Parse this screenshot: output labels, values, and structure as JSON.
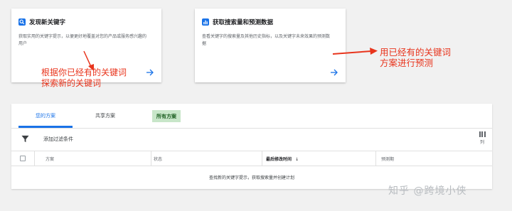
{
  "cards": [
    {
      "title": "发现新关键字",
      "description": "获取实用的关键字提示，以便更好地覆盖对您的产品或服务感兴趣的用户",
      "icon": "search-icon"
    },
    {
      "title": "获取搜索量和预测数据",
      "description": "查看关键字的搜索量及其他历史指标，以及关键字未来效果的预测数据",
      "icon": "bar-chart-icon"
    }
  ],
  "annotations": {
    "left": [
      "根据你已经有的关键词",
      "探索新的关键词"
    ],
    "right": [
      "用已经有的关键词",
      "方案进行预测"
    ]
  },
  "tabs": [
    {
      "label": "您的方案"
    },
    {
      "label": "共享方案"
    },
    {
      "label": "所有方案"
    }
  ],
  "filter": {
    "label": "添加过滤条件"
  },
  "columns": {
    "label": "列"
  },
  "table": {
    "headers": [
      "方案",
      "状态",
      "最后修改时间",
      "预测期"
    ],
    "sort_indicator": "↓",
    "empty_message": "查找新的关键字提示，获取搜索量并创建计划"
  },
  "watermark": "知乎 @跨境小侠",
  "colors": {
    "accent": "#1a73e8",
    "annotation": "#e8341c",
    "tab_highlight": "#c8e6c9"
  }
}
